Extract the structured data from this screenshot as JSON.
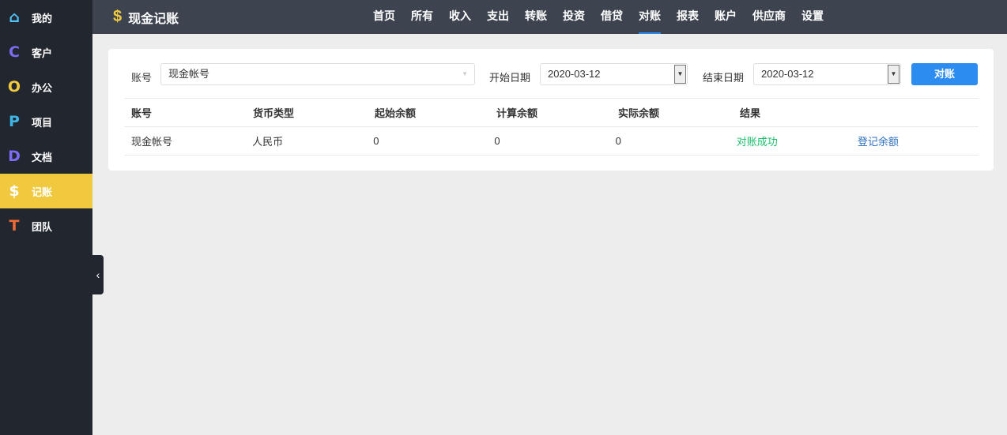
{
  "sidebar": {
    "items": [
      {
        "label": "我的",
        "icon": "⌂",
        "color": "#4fc3f7"
      },
      {
        "label": "客户",
        "icon": "C",
        "color": "#7b6cf6"
      },
      {
        "label": "办公",
        "icon": "O",
        "color": "#f0c93f"
      },
      {
        "label": "项目",
        "icon": "P",
        "color": "#3fb6e8"
      },
      {
        "label": "文档",
        "icon": "D",
        "color": "#7b6cf6"
      },
      {
        "label": "记账",
        "icon": "$",
        "color": "#ffffff"
      },
      {
        "label": "团队",
        "icon": "T",
        "color": "#f06a35"
      }
    ]
  },
  "header": {
    "icon": "$",
    "title": "现金记账",
    "nav": [
      "首页",
      "所有",
      "收入",
      "支出",
      "转账",
      "投资",
      "借贷",
      "对账",
      "报表",
      "账户",
      "供应商",
      "设置"
    ],
    "active": "对账"
  },
  "form": {
    "account_label": "账号",
    "account_value": "现金帐号",
    "start_label": "开始日期",
    "start_value": "2020-03-12",
    "end_label": "结束日期",
    "end_value": "2020-03-12",
    "submit": "对账"
  },
  "table": {
    "headers": [
      "账号",
      "货币类型",
      "起始余额",
      "计算余额",
      "实际余额",
      "结果"
    ],
    "rows": [
      {
        "account": "现金帐号",
        "currency": "人民币",
        "start": "0",
        "calc": "0",
        "actual": "0",
        "result": "对账成功",
        "action": "登记余额"
      }
    ]
  },
  "colors": {
    "success": "#19be6b",
    "link": "#2d6fc0",
    "accent": "#2d8cf0"
  }
}
